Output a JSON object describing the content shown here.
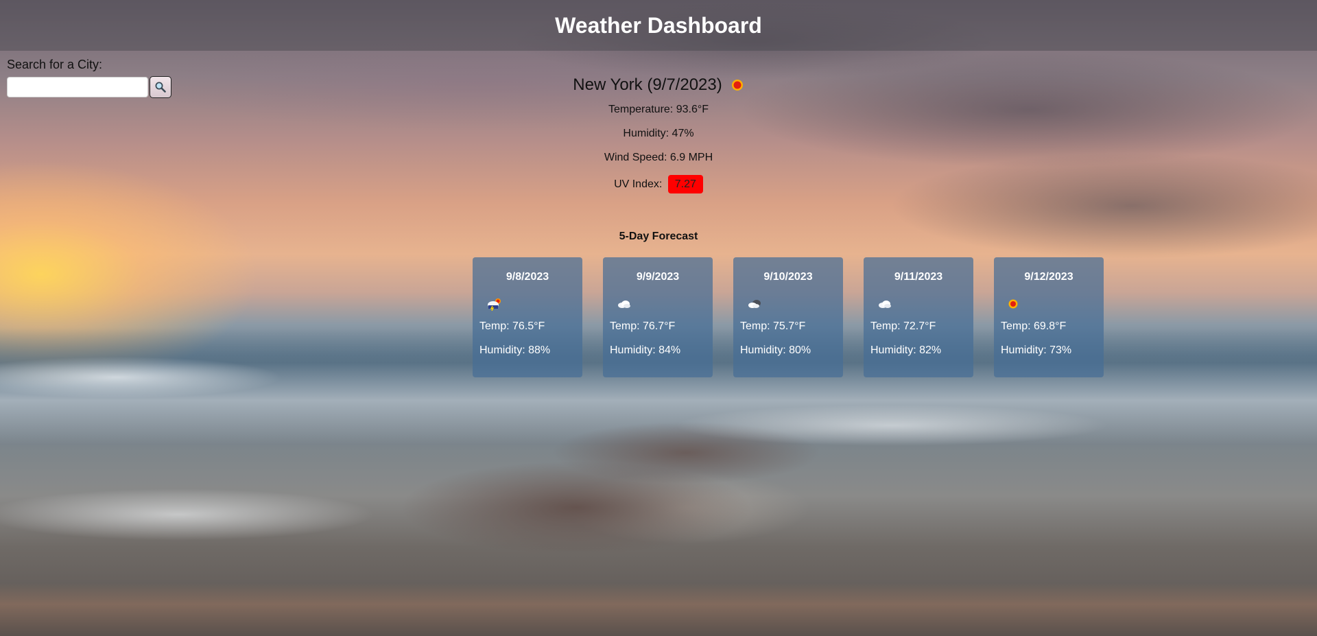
{
  "header": {
    "title": "Weather Dashboard"
  },
  "search": {
    "label": "Search for a City:",
    "value": "",
    "placeholder": "",
    "button_icon": "magnifier-icon"
  },
  "current": {
    "city_title": "New York (9/7/2023)",
    "icon": "sun-icon",
    "temperature": "Temperature: 93.6°F",
    "humidity": "Humidity: 47%",
    "wind": "Wind Speed: 6.9 MPH",
    "uv_label": "UV Index:",
    "uv_value": "7.27",
    "uv_color": "#ff0000"
  },
  "forecast": {
    "title": "5-Day Forecast",
    "card_color": "#466e96",
    "days": [
      {
        "date": "9/8/2023",
        "icon": "thunderstorm-sun-icon",
        "temp": "Temp: 76.5°F",
        "humidity": "Humidity: 88%"
      },
      {
        "date": "9/9/2023",
        "icon": "cloud-icon",
        "temp": "Temp: 76.7°F",
        "humidity": "Humidity: 84%"
      },
      {
        "date": "9/10/2023",
        "icon": "partly-cloudy-icon",
        "temp": "Temp: 75.7°F",
        "humidity": "Humidity: 80%"
      },
      {
        "date": "9/11/2023",
        "icon": "cloud-icon",
        "temp": "Temp: 72.7°F",
        "humidity": "Humidity: 82%"
      },
      {
        "date": "9/12/2023",
        "icon": "sun-icon",
        "temp": "Temp: 69.8°F",
        "humidity": "Humidity: 73%"
      }
    ]
  }
}
